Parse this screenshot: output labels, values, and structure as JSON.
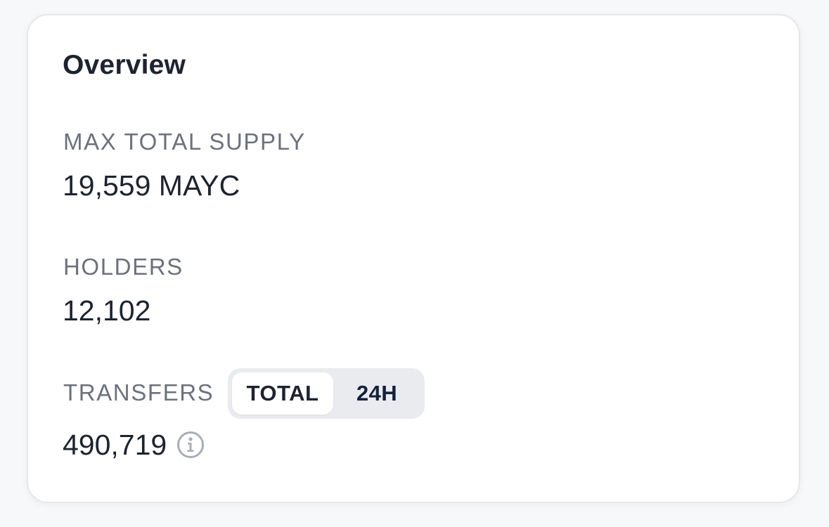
{
  "overview": {
    "title": "Overview",
    "max_total_supply": {
      "label": "MAX TOTAL SUPPLY",
      "value": "19,559 MAYC"
    },
    "holders": {
      "label": "HOLDERS",
      "value": "12,102"
    },
    "transfers": {
      "label": "TRANSFERS",
      "value": "490,719",
      "info_icon": "info-circle-icon",
      "toggle": {
        "options": [
          "TOTAL",
          "24H"
        ],
        "selected": "TOTAL"
      }
    }
  },
  "colors": {
    "card_background": "#ffffff",
    "card_border": "#e6e7ea",
    "label_text": "#6c717c",
    "value_text": "#1d2330",
    "toggle_background": "#eaebee",
    "toggle_inactive_text": "#14213d"
  }
}
